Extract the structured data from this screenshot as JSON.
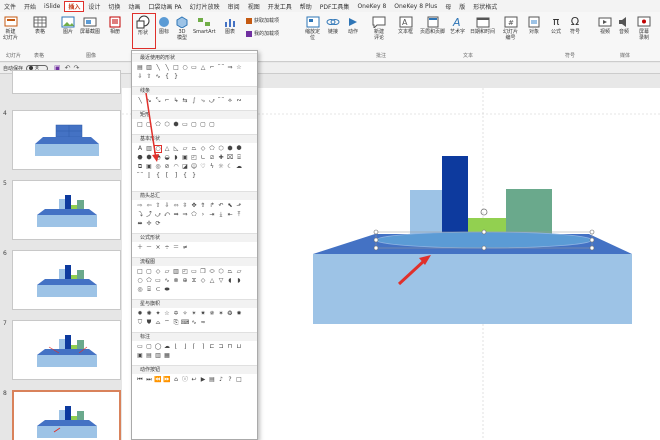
{
  "menu": {
    "tabs": [
      "文件",
      "开始",
      "iSlide",
      "插入",
      "设计",
      "切换",
      "动画",
      "口袋动画 PA",
      "幻灯片放映",
      "审阅",
      "视图",
      "开发工具",
      "帮助",
      "PDF工具集",
      "OneKey 8",
      "OneKey 8 Plus",
      "母",
      "版",
      "形状格式"
    ],
    "active_tab": "插入"
  },
  "ribbon": {
    "new_slide": "新建\n幻灯片",
    "table": "表格",
    "picture": "图片",
    "screenshot": "屏幕截图",
    "album": "相册",
    "shapes": "形状",
    "icons": "图标",
    "model3d": "3D\n模型",
    "smartart": "SmartArt",
    "chart": "图表",
    "addins_get": "获取加载项",
    "addins_my": "我的加载项",
    "zoom": "缩放定\n位",
    "link": "链接",
    "action": "动作",
    "comment": "新建\n评论",
    "textbox": "文本框",
    "header_footer": "页眉和页脚",
    "wordart": "艺术字",
    "datetime": "日期和时间",
    "slide_number": "幻灯片\n编号",
    "object": "对象",
    "equation": "公式",
    "symbol": "符号",
    "video": "视频",
    "audio": "音频",
    "screen_record": "屏幕\n录制",
    "groups": {
      "slides": "幻灯片",
      "tables": "表格",
      "images": "图像",
      "comments": "批注",
      "text": "文本",
      "symbols": "符号",
      "media": "媒体"
    }
  },
  "quick_access": {
    "autosave": "自动保存",
    "toggle_state": "关"
  },
  "slides": [
    {
      "number": "4"
    },
    {
      "number": "5"
    },
    {
      "number": "6"
    },
    {
      "number": "7"
    },
    {
      "number": "8"
    }
  ],
  "shapes_menu": {
    "sections": [
      "最近使用的形状",
      "线条",
      "矩形",
      "基本形状",
      "箭头总汇",
      "公式形状",
      "流程图",
      "星与旗帜",
      "标注",
      "动作按钮"
    ]
  },
  "colors": {
    "accent_red": "#e0302b",
    "base_blue": "#9dc3e6",
    "top_blue": "#4472c4",
    "navy_bar": "#0d3a9e",
    "light_bar": "#9dc3e6",
    "green_bar": "#92d050",
    "teal_bar": "#6aa98c",
    "ellipse_blue": "#5b9bd5"
  }
}
